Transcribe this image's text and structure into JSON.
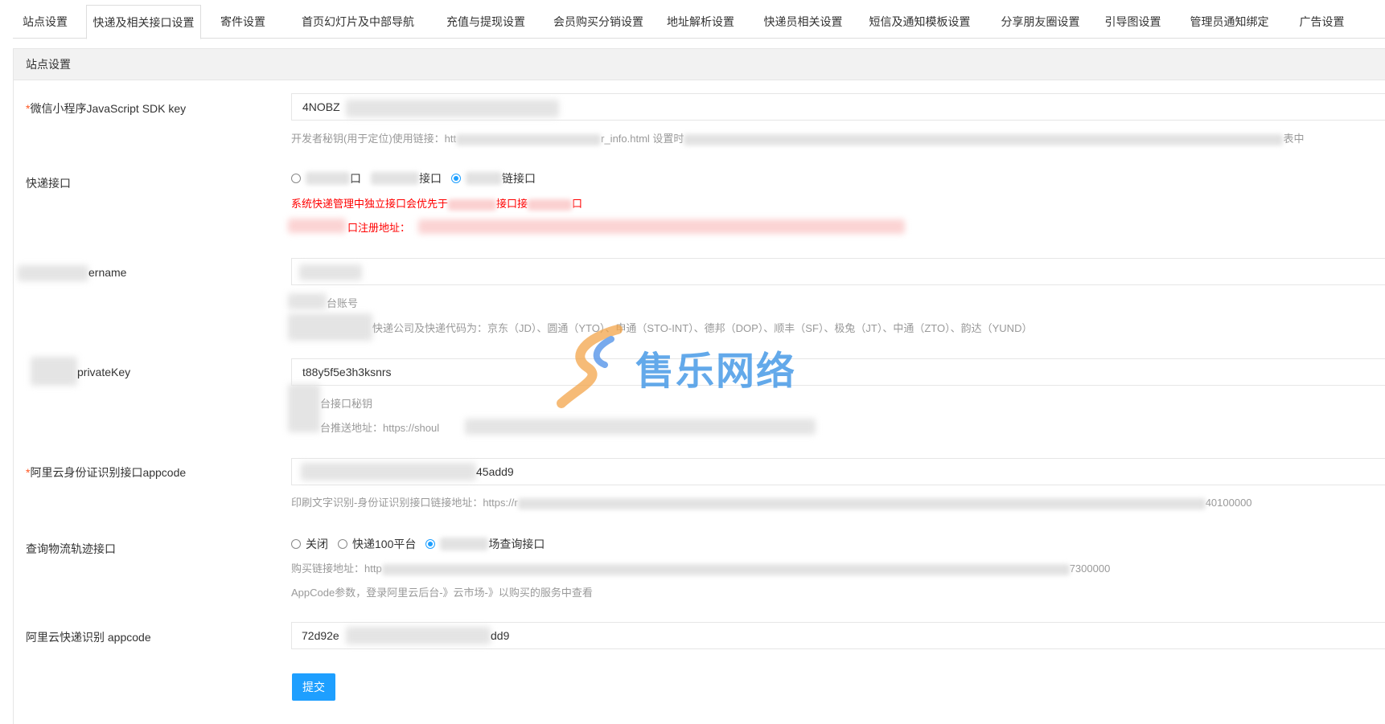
{
  "tabs": [
    {
      "label": "站点设置"
    },
    {
      "label": "快递及相关接口设置"
    },
    {
      "label": "寄件设置"
    },
    {
      "label": "首页幻灯片及中部导航"
    },
    {
      "label": "充值与提现设置"
    },
    {
      "label": "会员购买分销设置"
    },
    {
      "label": "地址解析设置"
    },
    {
      "label": "快递员相关设置"
    },
    {
      "label": "短信及通知模板设置"
    },
    {
      "label": "分享朋友圈设置"
    },
    {
      "label": "引导图设置"
    },
    {
      "label": "管理员通知绑定"
    },
    {
      "label": "广告设置"
    }
  ],
  "panel": {
    "title": "站点设置"
  },
  "form": {
    "sdk_key": {
      "required_mark": "*",
      "label": "微信小程序JavaScript SDK key",
      "value": "4NOBZ",
      "tip_prefix": "开发者秘钥(用于定位)使用链接：htt",
      "tip_mid": "r_info.html 设置时",
      "tip_end": "表中"
    },
    "express_api": {
      "label": "快递接口",
      "options": [
        {
          "label": "口",
          "checked": false
        },
        {
          "label": "接口",
          "checked": false
        },
        {
          "label": "链接口",
          "checked": true
        }
      ],
      "warn1_a": "系统快递管理中独立接口会优先于",
      "warn1_b": "接口接",
      "warn1_c": "口",
      "warn2": "口注册地址："
    },
    "username": {
      "label": "ername",
      "tip1": "台账号",
      "tip2": "快递公司及快递代码为：京东（JD）、圆通（YTO）、申通（STO-INT）、德邦（DOP）、顺丰（SF）、极兔（JT）、中通（ZTO）、韵达（YUND）"
    },
    "private_key": {
      "label": "privateKey",
      "value": "t88y5f5e3h3ksnrs",
      "tip1": "台接口秘钥",
      "tip2": "台推送地址：https://shoul"
    },
    "aliyun_id": {
      "required_mark": "*",
      "label": "阿里云身份证识别接口appcode",
      "value": "45add9",
      "tip_prefix": "印刷文字识别-身份证识别接口链接地址：https://r",
      "tip_end": "40100000"
    },
    "logistics": {
      "label": "查询物流轨迹接口",
      "options": [
        {
          "label": "关闭",
          "checked": false
        },
        {
          "label": "快递100平台",
          "checked": false
        },
        {
          "label": "场查询接口",
          "checked": true
        }
      ],
      "tip1_prefix": "购买链接地址：http",
      "tip1_end": "7300000",
      "tip2": "AppCode参数，登录阿里云后台-》云市场-》以购买的服务中查看"
    },
    "aliyun_express": {
      "label": "阿里云快递识别 appcode",
      "value_start": "72d92e",
      "value_end": "dd9"
    }
  },
  "submit_label": "提交",
  "watermark": {
    "text": "售乐网络"
  }
}
